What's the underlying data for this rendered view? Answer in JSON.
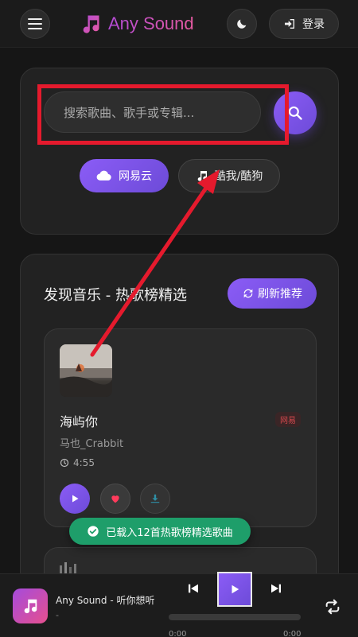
{
  "header": {
    "logo_text": "Any Sound",
    "login_label": "登录"
  },
  "search": {
    "placeholder": "搜索歌曲、歌手或专辑...",
    "sources": [
      "网易云",
      "酷我/酷狗"
    ]
  },
  "discover": {
    "title": "发现音乐 - 热歌榜精选",
    "refresh_label": "刷新推荐",
    "songs": [
      {
        "title": "海屿你",
        "artist": "马也_Crabbit",
        "duration": "4:55",
        "source_tag": "网易"
      }
    ]
  },
  "toast": {
    "message": "已载入12首热歌榜精选歌曲"
  },
  "player": {
    "title": "Any Sound - 听你想听",
    "subtitle": "-",
    "current_time": "0:00",
    "total_time": "0:00",
    "progress": 0
  },
  "colors": {
    "accent": "#8b5cf6",
    "brand_gradient_start": "#b34bd6",
    "brand_gradient_end": "#e65aa0",
    "toast_green": "#1e9e6a",
    "annotation_red": "#e51a2d"
  },
  "icons": [
    "menu-icon",
    "music-note-icon",
    "moon-icon",
    "login-icon",
    "search-icon",
    "cloud-icon",
    "refresh-icon",
    "clock-icon",
    "play-icon",
    "heart-icon",
    "download-icon",
    "check-circle-icon",
    "prev-icon",
    "next-icon",
    "repeat-icon"
  ]
}
